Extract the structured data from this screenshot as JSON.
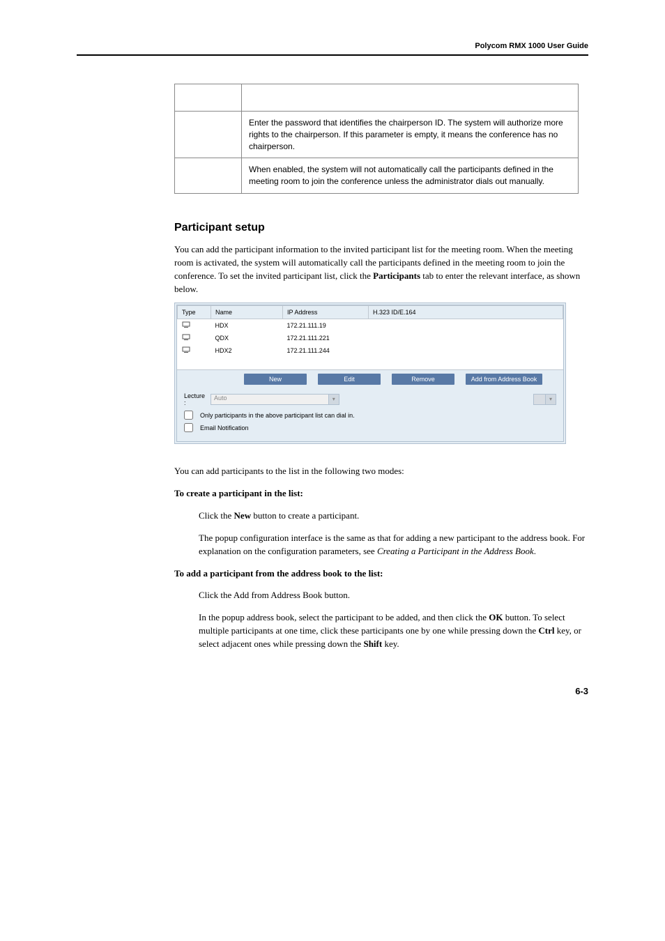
{
  "header": {
    "title": "Polycom RMX 1000 User Guide"
  },
  "table": {
    "rows": [
      {
        "param": "",
        "desc": "Enter the password that identifies the chairperson ID. The system will authorize more rights to the chairperson. If this parameter is empty, it means the conference has no chairperson."
      },
      {
        "param": "",
        "desc": "When enabled, the system will not automatically call the participants defined in the meeting room to join the conference unless the administrator dials out manually."
      }
    ]
  },
  "section": {
    "heading": "Participant setup",
    "intro_1": "You can add the participant information to the invited participant list for the meeting room. When the meeting room is activated, the system will automatically call the participants defined in the meeting room to join the conference. To set the invited participant list, click the ",
    "intro_bold": "Participants",
    "intro_2": " tab to enter the relevant interface, as shown below."
  },
  "screenshot": {
    "columns": {
      "type": "Type",
      "name": "Name",
      "ip": "IP Address",
      "h323": "H.323 ID/E.164"
    },
    "rows": [
      {
        "name": "HDX",
        "ip": "172.21.111.19"
      },
      {
        "name": "QDX",
        "ip": "172.21.111.221"
      },
      {
        "name": "HDX2",
        "ip": "172.21.111.244"
      }
    ],
    "buttons": {
      "new": "New",
      "edit": "Edit",
      "remove": "Remove",
      "add": "Add from Address Book"
    },
    "footer": {
      "lecture_label": "Lecture :",
      "lecture_value": "Auto",
      "only_participants": "Only participants in the above participant list can dial in.",
      "email_notification": "Email Notification"
    }
  },
  "body2": {
    "two_modes": "You can add participants to the list in the following two modes:",
    "create_heading": "To create a participant in the list:",
    "create_step1_a": "Click the ",
    "create_step1_bold": "New",
    "create_step1_b": " button to create a participant.",
    "create_step2_a": "The popup configuration interface is the same as that for adding a new participant to the address book. For explanation on the configuration parameters, see ",
    "create_step2_italic": "Creating a Participant in the Address Book",
    "create_step2_b": ".",
    "add_heading": "To add a participant from the address book to the list:",
    "add_step1": "Click the Add from Address Book button.",
    "add_step2_a": "In the popup address book, select the participant to be added, and then click the ",
    "add_step2_bold1": "OK",
    "add_step2_b": " button. To select multiple participants at one time, click these participants one by one while pressing down the ",
    "add_step2_bold2": "Ctrl",
    "add_step2_c": " key, or select adjacent ones while pressing down the ",
    "add_step2_bold3": "Shift",
    "add_step2_d": " key."
  },
  "footer": {
    "page": "6-3"
  }
}
